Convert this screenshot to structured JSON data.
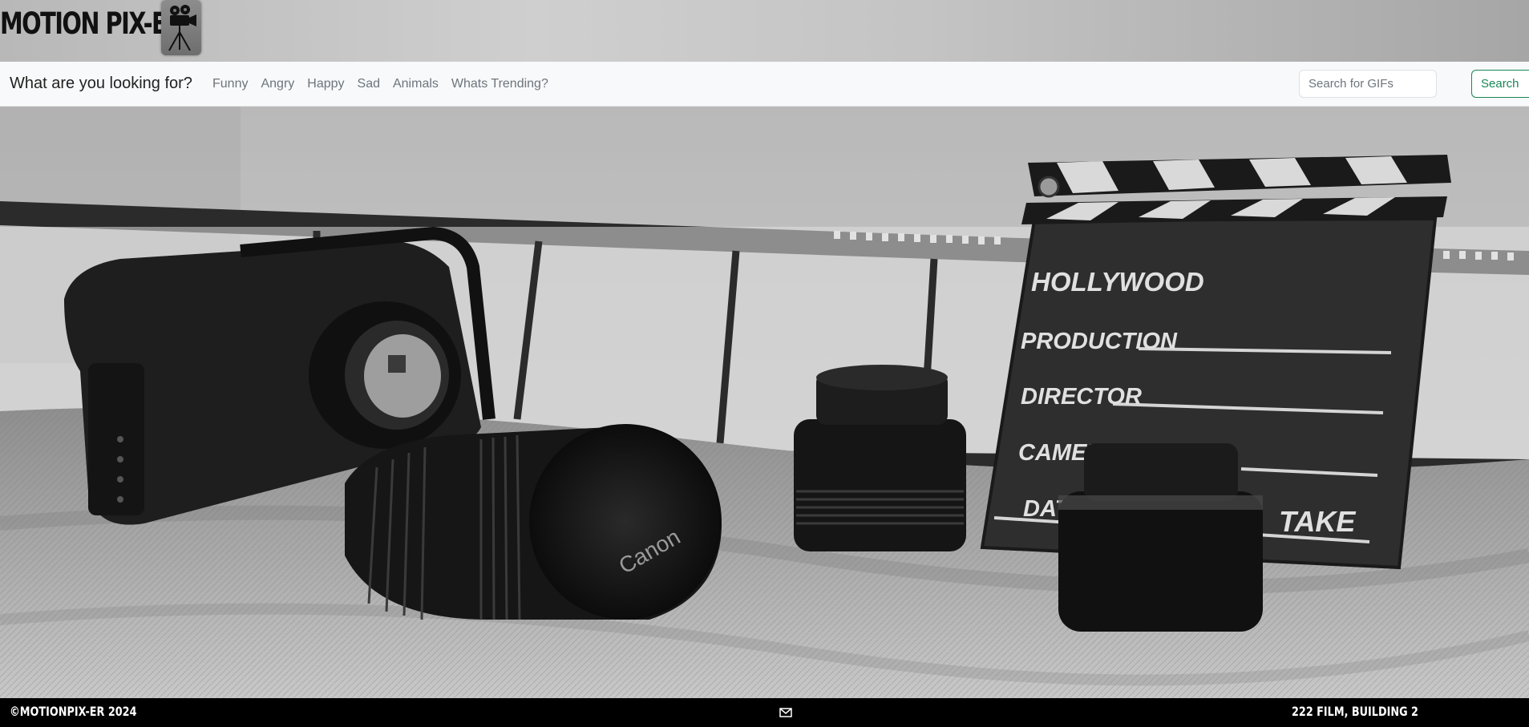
{
  "header": {
    "logo_text": "MOTION PIX-ER",
    "logo_icon": "movie-camera-icon"
  },
  "navbar": {
    "brand": "What are you looking for?",
    "links": [
      "Funny",
      "Angry",
      "Happy",
      "Sad",
      "Animals",
      "Whats Trending?"
    ],
    "search_placeholder": "Search for GIFs",
    "search_button": "Search",
    "search_button_color": "#198754"
  },
  "hero": {
    "clapperboard_title": "HOLLYWOOD",
    "clapperboard_fields": [
      "PRODUCTION",
      "DIRECTOR",
      "CAMERA",
      "DATE",
      "TAKE"
    ]
  },
  "footer": {
    "copyright": "©MOTIONPIX-ER 2024",
    "mail_icon": "envelope-icon",
    "address": "222 FILM, BUILDING 2"
  }
}
